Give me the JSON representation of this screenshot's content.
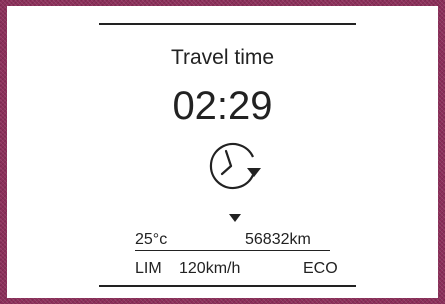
{
  "display": {
    "title": "Travel time",
    "time": "02:29",
    "icon": "clock-with-arrow-icon",
    "temperature": "25°c",
    "odometer": "56832km",
    "limit_label": "LIM",
    "limit_value": "120km/h",
    "mode": "ECO"
  },
  "colors": {
    "frame": "#8c2f5a",
    "screen": "#ffffff",
    "foreground": "#222222"
  }
}
